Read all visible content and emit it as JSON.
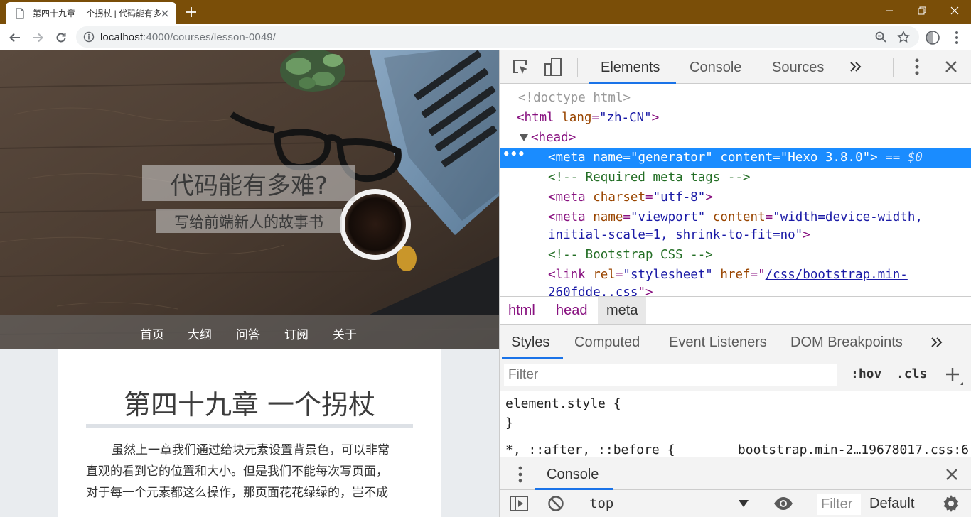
{
  "browser": {
    "tab_title": "第四十九章 一个拐杖 | 代码能有多难？",
    "url_host": "localhost",
    "url_path": ":4000/courses/lesson-0049/"
  },
  "page": {
    "hero_title": "代码能有多难?",
    "hero_subtitle": "写给前端新人的故事书",
    "nav": [
      "首页",
      "大纲",
      "问答",
      "订阅",
      "关于"
    ],
    "article_title": "第四十九章 一个拐杖",
    "paragraph_lines": [
      "虽然上一章我们通过给块元素设置背景色，可以非常",
      "直观的看到它的位置和大小。但是我们不能每次写页面，",
      "对于每一个元素都这么操作，那页面花花绿绿的，岂不成"
    ]
  },
  "devtools": {
    "tabs": [
      "Elements",
      "Console",
      "Sources"
    ],
    "active_tab": "Elements",
    "dom": {
      "doctype": "<!doctype html>",
      "html_tag": "html",
      "html_attr": "lang",
      "html_val": "\"zh-CN\"",
      "head_tag": "head",
      "meta_gen_name": "\"generator\"",
      "meta_gen_content": "\"Hexo 3.8.0\"",
      "selected_marker": "== $0",
      "comment1": "<!-- Required meta tags -->",
      "meta_charset_val": "\"utf-8\"",
      "meta_viewport_name": "\"viewport\"",
      "meta_viewport_content_1": "\"width=device-width,",
      "meta_viewport_content_2": "initial-scale=1, shrink-to-fit=no\"",
      "comment2": "<!-- Bootstrap CSS -->",
      "link_rel": "\"stylesheet\"",
      "link_href_1": "/css/bootstrap.min-",
      "link_href_2": "260fdde..css"
    },
    "breadcrumbs": [
      "html",
      "head",
      "meta"
    ],
    "styles_tabs": [
      "Styles",
      "Computed",
      "Event Listeners",
      "DOM Breakpoints"
    ],
    "filter_placeholder": "Filter",
    "hov": ":hov",
    "cls": ".cls",
    "rule1_selector": "element.style {",
    "rule1_close": "}",
    "rule2_selector": "*, ::after, ::before {",
    "rule2_source": "bootstrap.min-2…19678017.css:6",
    "drawer_tab": "Console",
    "context": "top",
    "console_filter": "Filter",
    "levels": "Default"
  },
  "colors": {
    "titlebar": "#7a4e08",
    "selection": "#1a8cff",
    "accent": "#1a73e8"
  }
}
